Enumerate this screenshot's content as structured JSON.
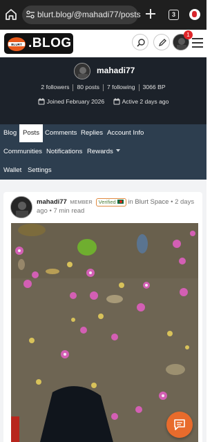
{
  "browser": {
    "url": "blurt.blog/@mahadi77/posts",
    "tab_count": "3"
  },
  "site": {
    "logo_badge_text": "BLURT",
    "logo_text": ".BLOG",
    "notification_count": "1"
  },
  "profile": {
    "username": "mahadi77",
    "followers": "2 followers",
    "posts": "80 posts",
    "following": "7 following",
    "bp": "3066 BP",
    "joined": "Joined February 2026",
    "active": "Active 2 days ago"
  },
  "tabs": {
    "blog": "Blog",
    "posts": "Posts",
    "comments": "Comments",
    "replies": "Replies",
    "account_info": "Account Info",
    "communities": "Communities",
    "notifications": "Notifications",
    "rewards": "Rewards",
    "wallet": "Wallet",
    "settings": "Settings",
    "active_tab": "Posts"
  },
  "post": {
    "author": "mahadi77",
    "role": "MEMBER",
    "verified": "Verified",
    "community_prefix": "in",
    "community": "Blurt Space",
    "time": "• 2 days ago • 7 min read"
  },
  "colors": {
    "browser_bar": "#1f1f1f",
    "profile_bg": "#1c222a",
    "tabs_bg": "#2d3e4f",
    "fab": "#e86b2c",
    "badge_red": "#e0262a"
  },
  "icons": {
    "home": "home-icon",
    "url_tune": "tune-icon",
    "new_tab": "plus-icon",
    "search": "search-icon",
    "pencil": "pencil-icon",
    "menu": "hamburger-icon",
    "calendar": "calendar-icon",
    "chat": "chat-icon"
  }
}
